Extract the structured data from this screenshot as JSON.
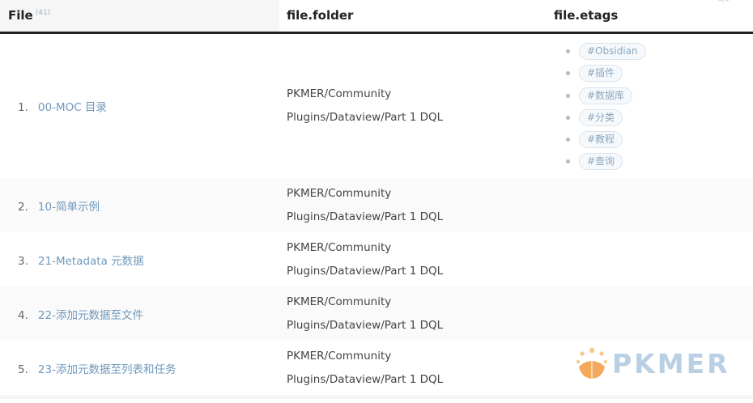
{
  "header": {
    "file_label": "File",
    "file_count": "(41)",
    "folder_label": "file.folder",
    "etags_label": "file.etags"
  },
  "rows": [
    {
      "index": "1.",
      "file": "00-MOC 目录",
      "folder_line1": "PKMER/Community",
      "folder_line2": "Plugins/Dataview/Part 1 DQL",
      "tags": [
        "#Obsidian",
        "#插件",
        "#数据库",
        "#分类",
        "#教程",
        "#查询"
      ]
    },
    {
      "index": "2.",
      "file": "10-简单示例",
      "folder_line1": "PKMER/Community",
      "folder_line2": "Plugins/Dataview/Part 1 DQL"
    },
    {
      "index": "3.",
      "file": "21-Metadata 元数据",
      "folder_line1": "PKMER/Community",
      "folder_line2": "Plugins/Dataview/Part 1 DQL"
    },
    {
      "index": "4.",
      "file": "22-添加元数据至文件",
      "folder_line1": "PKMER/Community",
      "folder_line2": "Plugins/Dataview/Part 1 DQL"
    },
    {
      "index": "5.",
      "file": "23-添加元数据至列表和任务",
      "folder_line1": "PKMER/Community",
      "folder_line2": "Plugins/Dataview/Part 1 DQL"
    }
  ],
  "watermark": {
    "text": "PKMER"
  },
  "code_icon": "</>",
  "colors": {
    "link": "#6f98bd",
    "tag_text": "#8aa6bf",
    "header_rule": "#222222",
    "watermark": "#b9cfe4"
  },
  "icons": {
    "code": "code-block-icon",
    "logo": "pkmer-logo-icon"
  }
}
